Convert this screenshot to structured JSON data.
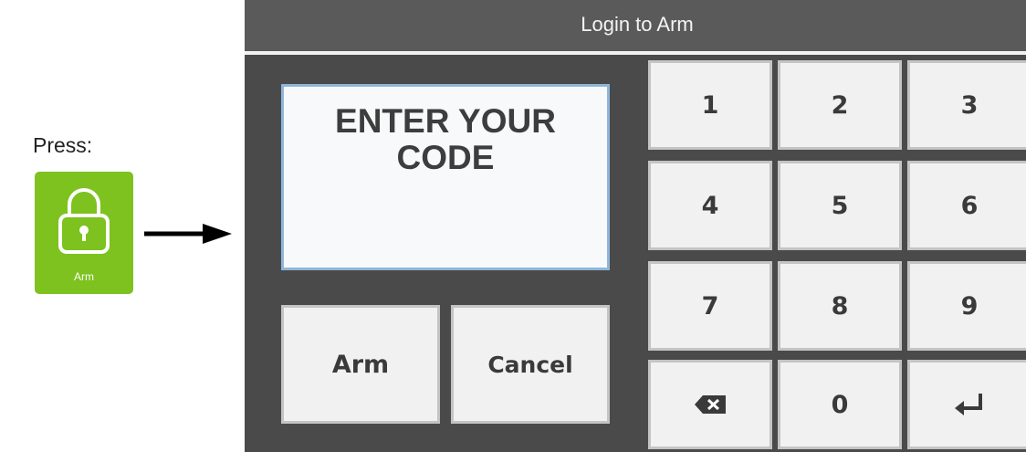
{
  "instruction": {
    "press_label": "Press:",
    "arm_tile_label": "Arm",
    "tile_color": "#7dc21e",
    "icon": "lock-icon"
  },
  "screen": {
    "title": "Login to Arm",
    "prompt_line1": "ENTER YOUR",
    "prompt_line2": "CODE",
    "arm_button": "Arm",
    "cancel_button": "Cancel"
  },
  "keypad": {
    "keys": [
      "1",
      "2",
      "3",
      "4",
      "5",
      "6",
      "7",
      "8",
      "9"
    ],
    "zero": "0",
    "backspace_icon": "backspace-icon",
    "enter_icon": "enter-icon"
  }
}
